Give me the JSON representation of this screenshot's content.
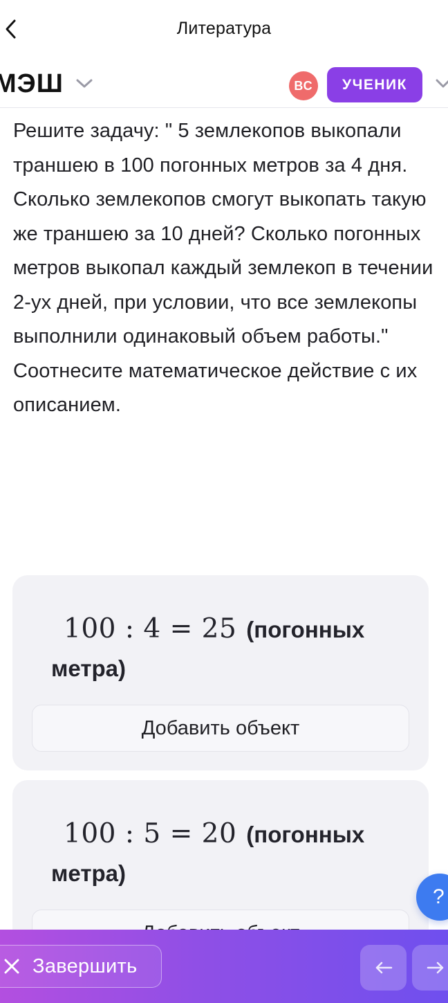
{
  "header": {
    "title": "Литература"
  },
  "brand": {
    "name": "МЭШ"
  },
  "user": {
    "initials": "ВС",
    "role": "УЧЕНИК"
  },
  "question": {
    "text": "Решите задачу: \" 5 землекопов выкопали траншею в 100 погонных метров за 4 дня. Сколько землекопов смогут выкопать такую же траншею за 10 дней? Сколько погонных метров выкопал каждый землекоп в течении 2-ух дней, при условии, что все землекопы выполнили одинаковый объем работы.\"",
    "instruction": "Соотнесите математическое действие с их описанием."
  },
  "cards": [
    {
      "math": "100 : 4 = 25",
      "description": "(погонных метра)",
      "add_label": "Добавить объект"
    },
    {
      "math": "100 : 5 = 20",
      "description": "(погонных метра)",
      "add_label": "Добавить объект"
    }
  ],
  "help": {
    "label": "?"
  },
  "footer": {
    "finish_label": "Завершить"
  },
  "colors": {
    "role_badge": "#8a3fe6",
    "avatar": "#ef6b6b",
    "help": "#3d7bf0",
    "bar_start": "#b34fe0",
    "bar_end": "#6f4fee"
  }
}
